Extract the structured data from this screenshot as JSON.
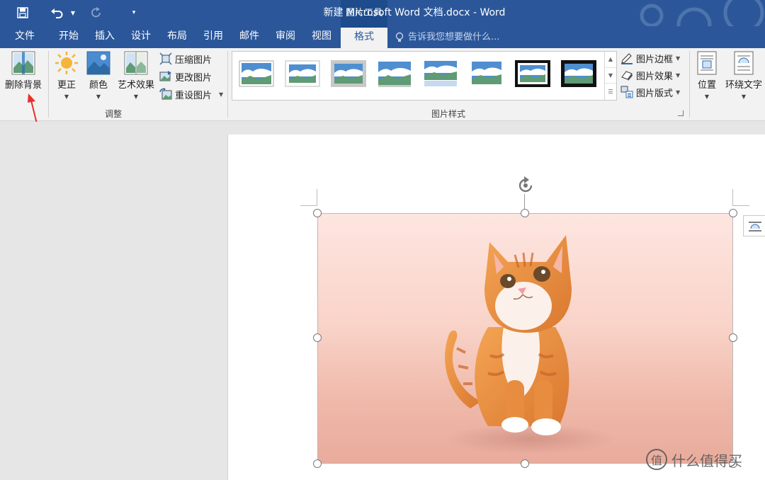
{
  "title_bar": {
    "context_group": "图片工具",
    "document_title": "新建 Microsoft Word 文档.docx - Word"
  },
  "tabs": [
    "文件",
    "开始",
    "插入",
    "设计",
    "布局",
    "引用",
    "邮件",
    "审阅",
    "视图",
    "格式"
  ],
  "active_tab": "格式",
  "tell_me": "告诉我您想要做什么...",
  "ribbon": {
    "adjust": {
      "remove_background": "删除背景",
      "corrections": "更正",
      "color": "颜色",
      "artistic_effects": "艺术效果",
      "compress": "压缩图片",
      "change": "更改图片",
      "reset": "重设图片",
      "group_label": "调整"
    },
    "styles": {
      "picture_border": "图片边框",
      "picture_effects": "图片效果",
      "picture_layout": "图片版式",
      "group_label": "图片样式"
    },
    "arrange": {
      "position": "位置",
      "wrap_text": "环绕文字"
    }
  },
  "watermark": {
    "logo_char": "值",
    "text": "什么值得买"
  },
  "colors": {
    "title_blue": "#2b579a",
    "ribbon_bg": "#f2f2f2",
    "annotation_arrow": "#e8302a"
  }
}
